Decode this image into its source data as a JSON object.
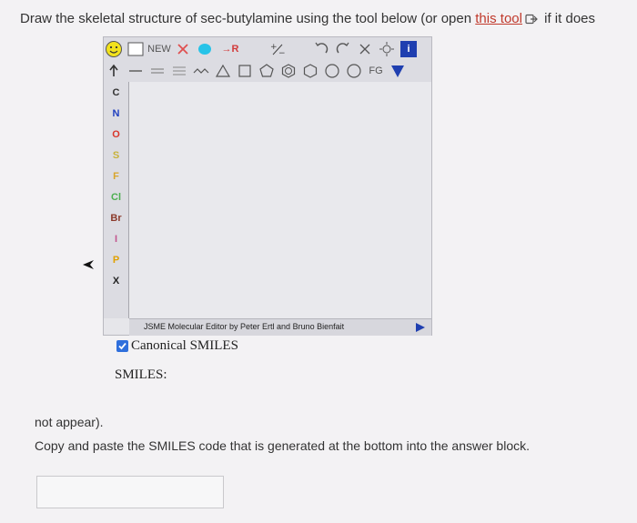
{
  "instruction": {
    "prefix": "Draw the skeletal structure of sec-butylamine using the tool below (or open ",
    "link_text": "this tool",
    "suffix": " if it does"
  },
  "editor": {
    "toolbar": {
      "new_label": "NEW",
      "r_label": "→R",
      "fg_label": "FG",
      "info_label": "i"
    },
    "atoms": [
      "C",
      "N",
      "O",
      "S",
      "F",
      "Cl",
      "Br",
      "I",
      "P",
      "X"
    ],
    "atom_colors": [
      "#333333",
      "#1f3fbf",
      "#d9362b",
      "#c8b23a",
      "#d9a52b",
      "#4caf50",
      "#8b3a2b",
      "#c2558e",
      "#e0a000",
      "#222222"
    ],
    "credit": "JSME Molecular Editor by Peter Ertl and Bruno Bienfait"
  },
  "canonical_smiles": {
    "label": "Canonical SMILES",
    "checked": true
  },
  "smiles_label": "SMILES:",
  "not_appear": "not appear).",
  "copy_instruction": "Copy and paste the SMILES code that is generated at the bottom into the answer block.",
  "answer": {
    "value": ""
  }
}
